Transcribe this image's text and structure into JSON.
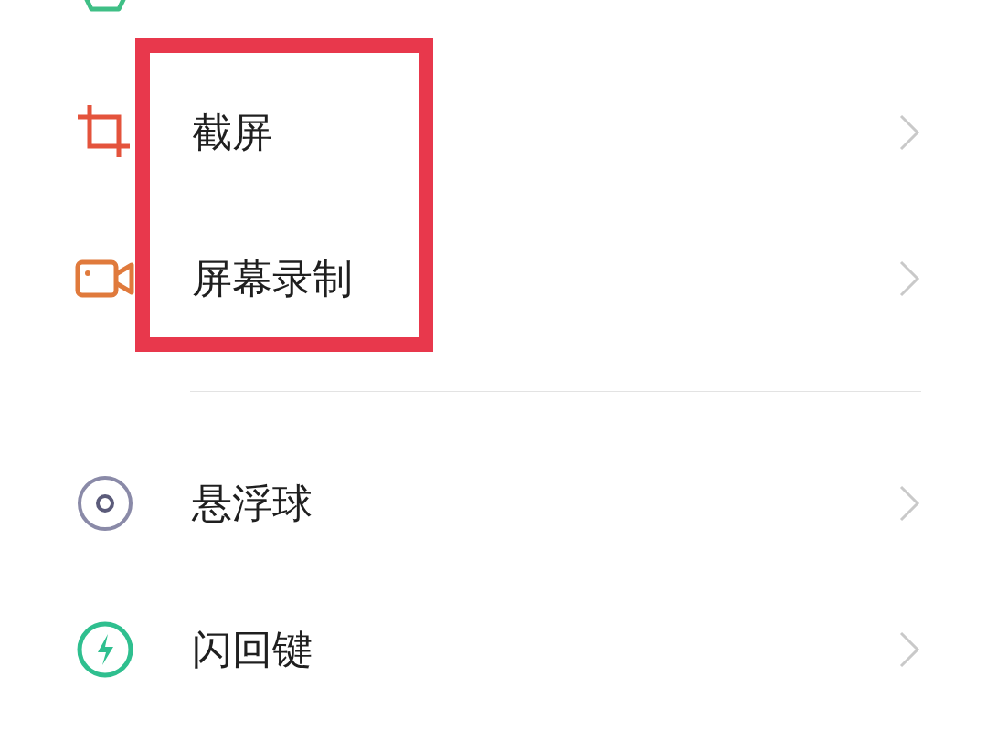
{
  "groups": [
    {
      "items": [
        {
          "kind": "gesture"
        }
      ]
    },
    {
      "highlighted": true,
      "items": [
        {
          "kind": "screenshot",
          "label": "截屏"
        },
        {
          "kind": "record",
          "label": "屏幕录制"
        }
      ]
    },
    {
      "items": [
        {
          "kind": "ball",
          "label": "悬浮球"
        },
        {
          "kind": "flash",
          "label": "闪回键"
        }
      ]
    }
  ]
}
